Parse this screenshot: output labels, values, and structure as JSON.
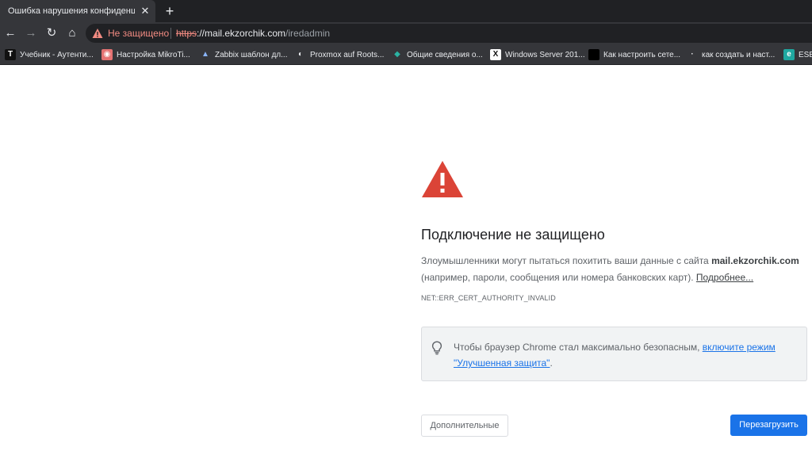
{
  "tab": {
    "title": "Ошибка нарушения конфиденциальности",
    "close_glyph": "✕",
    "new_tab_glyph": "+"
  },
  "toolbar": {
    "back_glyph": "←",
    "forward_glyph": "→",
    "reload_glyph": "↻",
    "home_glyph": "⌂"
  },
  "omnibox": {
    "security_label": "Не защищено",
    "url_scheme": "https",
    "url_host": "://mail.ekzorchik.com",
    "url_path": "/iredadmin"
  },
  "bookmarks": [
    {
      "label": "Учебник - Аутенти...",
      "icon": "T",
      "icon_bg": "#111111",
      "icon_color": "#ffffff"
    },
    {
      "label": "Настройка MikroTi...",
      "icon": "◉",
      "icon_bg": "#e57373",
      "icon_color": "#ffffff"
    },
    {
      "label": "Zabbix шаблон дл...",
      "icon": "▲",
      "icon_bg": "transparent",
      "icon_color": "#8ab4f8"
    },
    {
      "label": "Proxmox auf Roots...",
      "icon": "◐",
      "icon_bg": "transparent",
      "icon_color": "#e8eaed"
    },
    {
      "label": "Общие сведения о...",
      "icon": "◆",
      "icon_bg": "transparent",
      "icon_color": "#2bb3a3"
    },
    {
      "label": "Windows Server 201...",
      "icon": "X",
      "icon_bg": "#ffffff",
      "icon_color": "#111111"
    },
    {
      "label": "Как настроить сете...",
      "icon": "",
      "icon_bg": "#000000",
      "icon_color": "#ffffff"
    },
    {
      "label": "как создать и наст...",
      "icon": "·",
      "icon_bg": "transparent",
      "icon_color": "#e8eaed"
    },
    {
      "label": "ESET",
      "icon": "e",
      "icon_bg": "#1fa8a0",
      "icon_color": "#ffffff"
    }
  ],
  "main": {
    "heading": "Подключение не защищено",
    "explain_prefix": "Злоумышленники могут пытаться похитить ваши данные с сайта ",
    "explain_host": "mail.ekzorchik.com",
    "explain_suffix": "(например, пароли, сообщения или номера банковских карт). ",
    "learn_more": "Подробнее...",
    "error_code": "NET::ERR_CERT_AUTHORITY_INVALID"
  },
  "promo": {
    "text_prefix": "Чтобы браузер Chrome стал максимально безопасным, ",
    "link_text": "включите режим \"Улучшенная защита\"",
    "text_suffix": "."
  },
  "buttons": {
    "advanced": "Дополнительные",
    "reload": "Перезагрузить"
  },
  "colors": {
    "danger": "#db4437",
    "primary": "#1a73e8",
    "insecure": "#f28b82"
  }
}
